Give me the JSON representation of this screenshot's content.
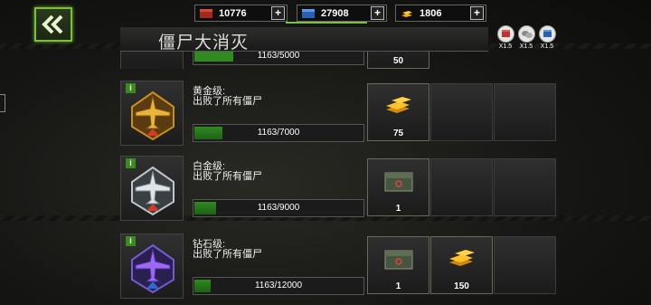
{
  "resources": [
    {
      "icon": "supply-crate-icon",
      "value": "10776",
      "color": "#c33a2a"
    },
    {
      "icon": "blue-crate-icon",
      "value": "27908",
      "color": "#3a7fd0"
    },
    {
      "icon": "gold-bars-icon",
      "value": "1806",
      "color": "#e0a218"
    }
  ],
  "boosts": [
    {
      "icon": "red-crate-boost-icon",
      "label": "X1.5"
    },
    {
      "icon": "white-bars-boost-icon",
      "label": "X1.5"
    },
    {
      "icon": "blue-crate-boost-icon",
      "label": "X1.5"
    }
  ],
  "page_title": "僵尸大消灭",
  "partial_row": {
    "progress_text": "1163/5000",
    "progress": 0.233,
    "reward_qty": "50"
  },
  "rows": [
    {
      "tier": "黄金级:",
      "req": "出败了所有僵尸",
      "progress_text": "1163/7000",
      "progress": 0.166,
      "medal": "gold-medal-icon",
      "rewards": [
        {
          "type": "gold-bars-icon",
          "qty": "75"
        }
      ]
    },
    {
      "tier": "白金级:",
      "req": "出败了所有僵尸",
      "progress_text": "1163/9000",
      "progress": 0.129,
      "medal": "platinum-medal-icon",
      "rewards": [
        {
          "type": "supply-case-icon",
          "qty": "1"
        }
      ]
    },
    {
      "tier": "钻石级:",
      "req": "出败了所有僵尸",
      "progress_text": "1163/12000",
      "progress": 0.097,
      "medal": "diamond-medal-icon",
      "rewards": [
        {
          "type": "supply-case-icon",
          "qty": "1"
        },
        {
          "type": "gold-bars-icon",
          "qty": "150"
        }
      ]
    }
  ]
}
